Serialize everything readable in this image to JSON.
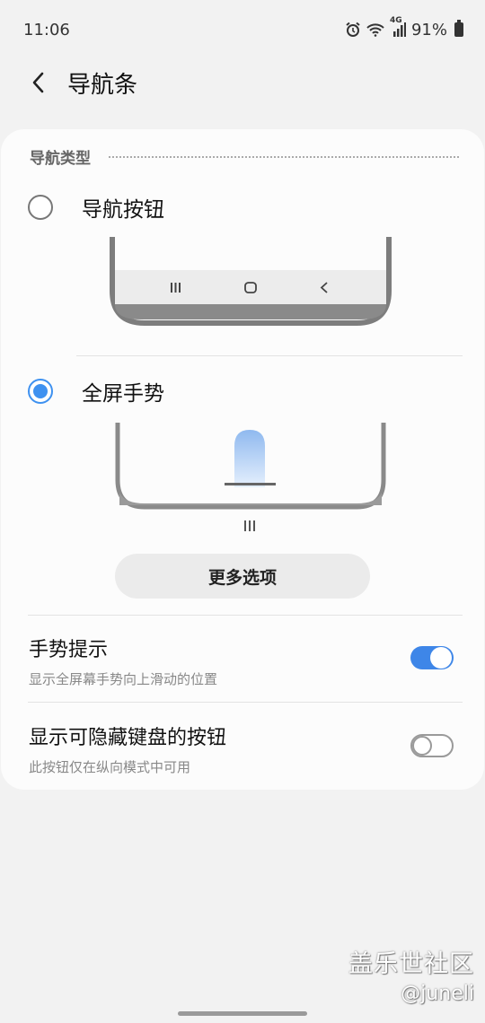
{
  "status_bar": {
    "time": "11:06",
    "network": "4G",
    "battery": "91%",
    "icons": [
      "alarm-icon",
      "wifi-icon",
      "signal-icon",
      "battery-icon"
    ]
  },
  "header": {
    "title": "导航条",
    "back_icon": "chevron-left-icon"
  },
  "nav_type": {
    "section_title": "导航类型",
    "options": [
      {
        "label": "导航按钮",
        "selected": false
      },
      {
        "label": "全屏手势",
        "selected": true
      }
    ],
    "more_options_label": "更多选项"
  },
  "settings": [
    {
      "title": "手势提示",
      "subtitle": "显示全屏幕手势向上滑动的位置",
      "enabled": true
    },
    {
      "title": "显示可隐藏键盘的按钮",
      "subtitle": "此按钮仅在纵向模式中可用",
      "enabled": false
    }
  ],
  "watermark": {
    "line1": "盖乐世社区",
    "line2": "@juneli"
  },
  "colors": {
    "accent": "#3e91f0",
    "background": "#f2f2f2",
    "card": "#fcfcfc"
  }
}
